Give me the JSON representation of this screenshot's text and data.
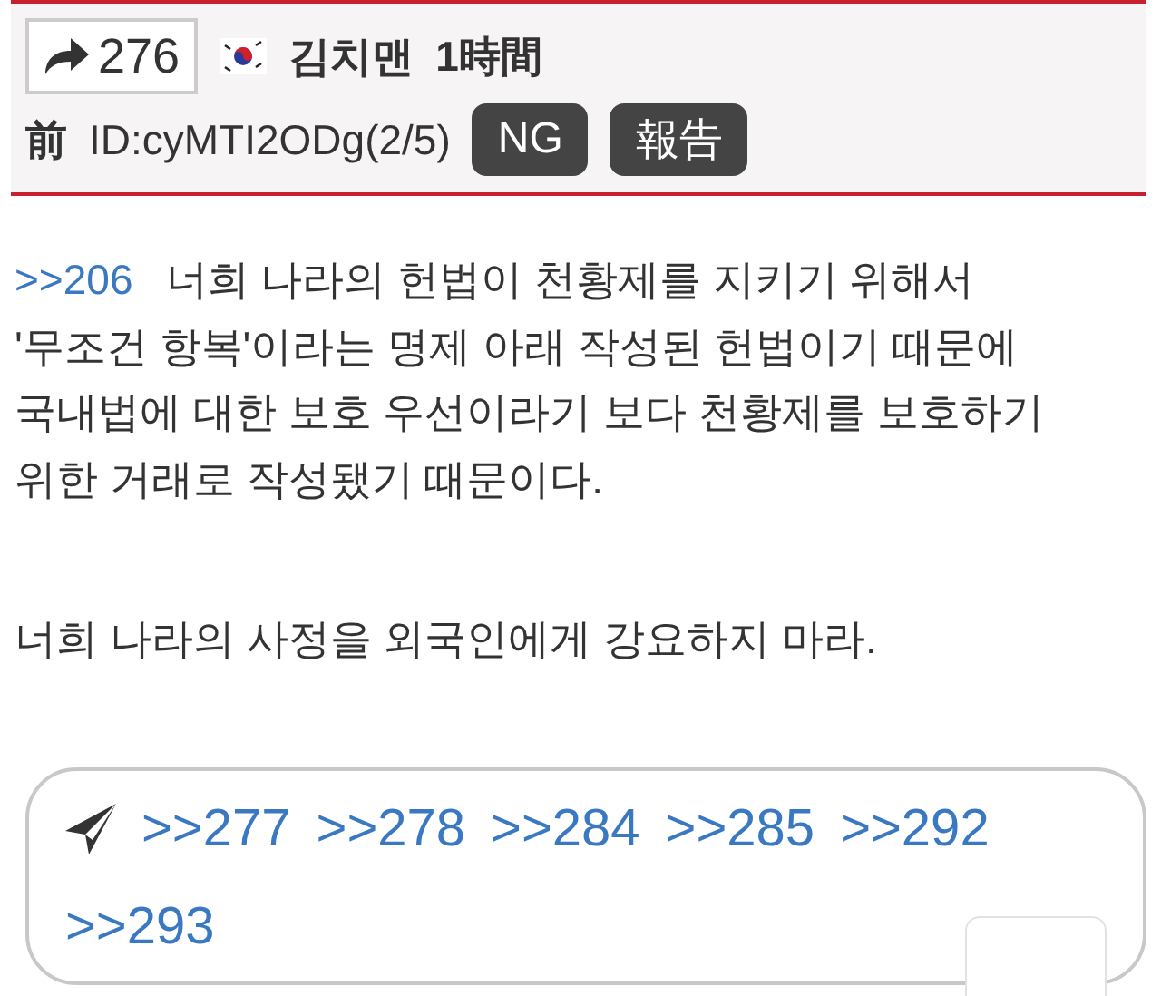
{
  "post": {
    "reply_count": "276",
    "name": "김치맨",
    "time": "1時間",
    "time_suffix": "前",
    "id": "ID:cyMTI2ODg(2/5)",
    "buttons": [
      "NG",
      "報告"
    ]
  },
  "body": {
    "anchor": ">>206",
    "paragraphs": [
      "너희 나라의 헌법이 천황제를 지키기 위해서\n'무조건 항복'이라는 명제 아래 작성된 헌법이기 때문에\n국내법에 대한 보호 우선이라기 보다 천황제를 보호하기\n위한 거래로 작성됐기 때문이다.",
      "너희 나라의 사정을 외국인에게 강요하지 마라."
    ]
  },
  "replies": [
    ">>277",
    ">>278",
    ">>284",
    ">>285",
    ">>292",
    ">>293"
  ]
}
